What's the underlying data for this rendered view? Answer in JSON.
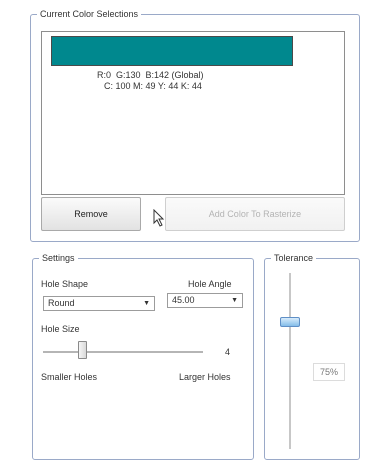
{
  "current_colors": {
    "legend": "Current Color Selections",
    "swatch_color": "#00888e",
    "rgb_text": "R:0  G:130  B:142 (Global)",
    "cmyk_text": "C: 100 M: 49 Y: 44 K: 44",
    "remove_label": "Remove",
    "add_label": "Add Color To Rasterize"
  },
  "settings": {
    "legend": "Settings",
    "hole_shape_label": "Hole Shape",
    "hole_angle_label": "Hole Angle",
    "hole_shape_value": "Round",
    "hole_angle_value": "45.00",
    "hole_size_label": "Hole Size",
    "hole_size_value": "4",
    "smaller_label": "Smaller Holes",
    "larger_label": "Larger Holes"
  },
  "tolerance": {
    "legend": "Tolerance",
    "value": "75%"
  }
}
